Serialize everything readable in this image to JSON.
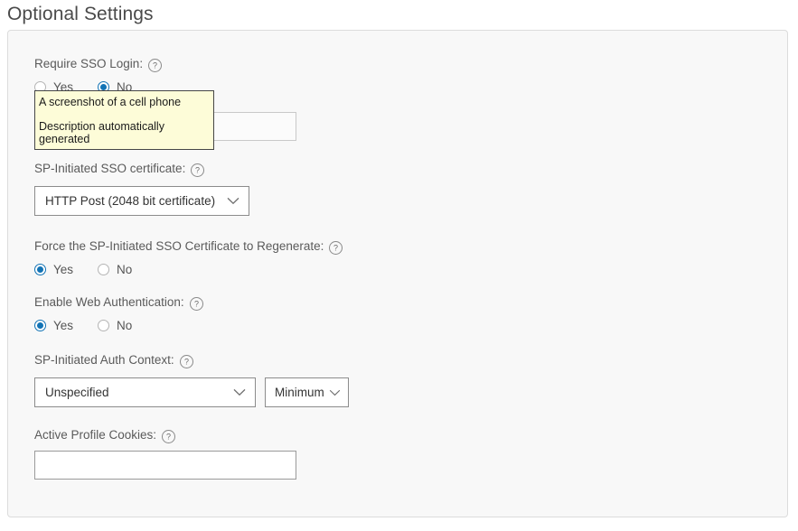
{
  "page": {
    "title": "Optional Settings"
  },
  "icons": {
    "help": "help-circle-icon",
    "chevron": "chevron-down-icon"
  },
  "tooltip": {
    "line1": "A screenshot of a cell phone",
    "line2": "Description automatically generated"
  },
  "fields": {
    "require_sso_login": {
      "label": "Require SSO Login:",
      "options": [
        {
          "label": "Yes",
          "checked": false
        },
        {
          "label": "No",
          "checked": true
        }
      ]
    },
    "hidden_text_input": {
      "value": "",
      "placeholder": ""
    },
    "sp_initiated_sso_certificate": {
      "label": "SP-Initiated SSO certificate:",
      "value": "HTTP Post (2048 bit certificate)"
    },
    "force_regenerate": {
      "label": "Force the SP-Initiated SSO Certificate to Regenerate:",
      "options": [
        {
          "label": "Yes",
          "checked": true
        },
        {
          "label": "No",
          "checked": false
        }
      ]
    },
    "enable_web_authentication": {
      "label": "Enable Web Authentication:",
      "options": [
        {
          "label": "Yes",
          "checked": true
        },
        {
          "label": "No",
          "checked": false
        }
      ]
    },
    "sp_initiated_auth_context": {
      "label": "SP-Initiated Auth Context:",
      "value": "Unspecified",
      "comparison_value": "Minimum"
    },
    "active_profile_cookies": {
      "label": "Active Profile Cookies:",
      "value": "",
      "placeholder": ""
    }
  },
  "colors": {
    "accent": "#1273b5",
    "panel_bg": "#f8f8f8",
    "panel_border": "#dcdcdc",
    "label_text": "#5a5a5a",
    "title_text": "#4a4a4a",
    "tooltip_bg": "#fdfcd8",
    "tooltip_border": "#464646"
  }
}
